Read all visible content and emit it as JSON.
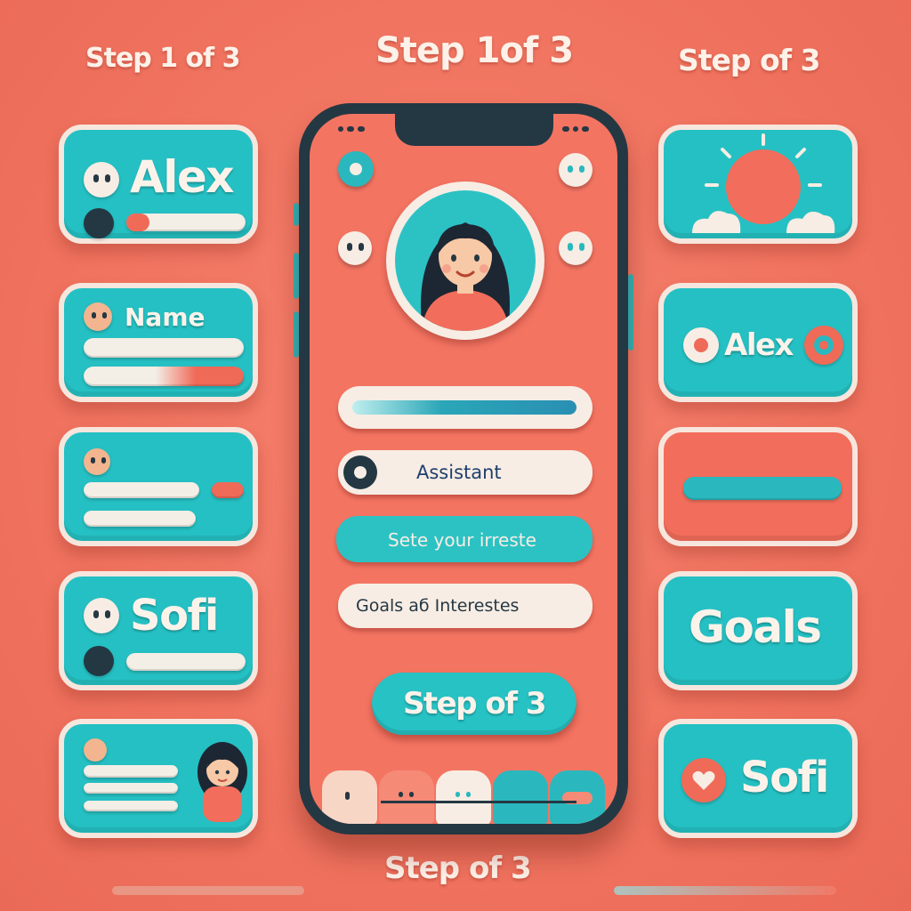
{
  "step_labels": {
    "top_left": "Step 1 of 3",
    "top_center": "Step 1of 3",
    "top_right": "Step of 3",
    "bottom": "Step of 3"
  },
  "left_cards": {
    "card1_name": "Alex",
    "card2_label": "Name",
    "card4_name": "Sofi"
  },
  "right_cards": {
    "card2_name": "Alex",
    "card4_title": "Goals",
    "card5_name": "Sofi"
  },
  "phone": {
    "assistant_label": "Assistant",
    "select_label": "Sete your irreste",
    "goals_label": "Goals аб Interestes",
    "cta_label": "Step of 3"
  },
  "colors": {
    "background": "#f0735f",
    "teal": "#25c0c3",
    "cream": "#f7ede4",
    "navy": "#243843",
    "coral": "#f26d5b"
  },
  "icons": [
    "smiley-icon",
    "avatar-icon",
    "sun-icon",
    "record-icon",
    "heart-icon",
    "status-icons"
  ]
}
